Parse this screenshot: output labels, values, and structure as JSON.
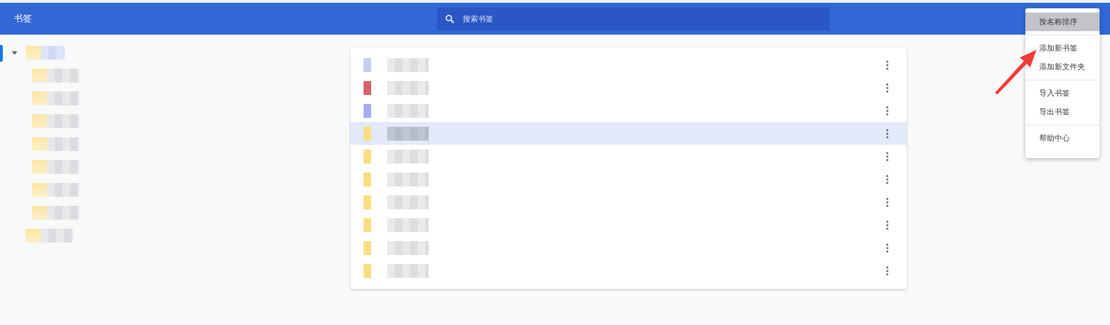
{
  "header": {
    "title": "书签",
    "search": {
      "placeholder": "搜索书签"
    }
  },
  "sidebar": {
    "items": [
      {
        "expanded": true,
        "selected": true,
        "children": [
          {
            "selected": false
          },
          {
            "selected": false
          },
          {
            "selected": false
          },
          {
            "selected": false
          },
          {
            "selected": false
          },
          {
            "selected": false
          },
          {
            "selected": false
          }
        ]
      },
      {
        "selected": false
      }
    ]
  },
  "list": {
    "rows": [
      {
        "kind": "page",
        "color": "#c8ccf2",
        "selected": false
      },
      {
        "kind": "page",
        "color": "#d9606a",
        "selected": false
      },
      {
        "kind": "page",
        "color": "#a9aaf0",
        "selected": false
      },
      {
        "kind": "folder",
        "selected": true
      },
      {
        "kind": "folder",
        "selected": false
      },
      {
        "kind": "folder",
        "selected": false
      },
      {
        "kind": "folder",
        "selected": false
      },
      {
        "kind": "folder",
        "selected": false
      },
      {
        "kind": "folder",
        "selected": false
      },
      {
        "kind": "folder",
        "selected": false
      }
    ]
  },
  "menu": {
    "groups": [
      [
        {
          "label": "按名称排序",
          "selected": true
        }
      ],
      [
        {
          "label": "添加新书签",
          "selected": false
        },
        {
          "label": "添加新文件夹",
          "selected": false
        }
      ],
      [
        {
          "label": "导入书签",
          "selected": false
        },
        {
          "label": "导出书签",
          "selected": false
        }
      ],
      [
        {
          "label": "帮助中心",
          "selected": false
        }
      ]
    ]
  }
}
